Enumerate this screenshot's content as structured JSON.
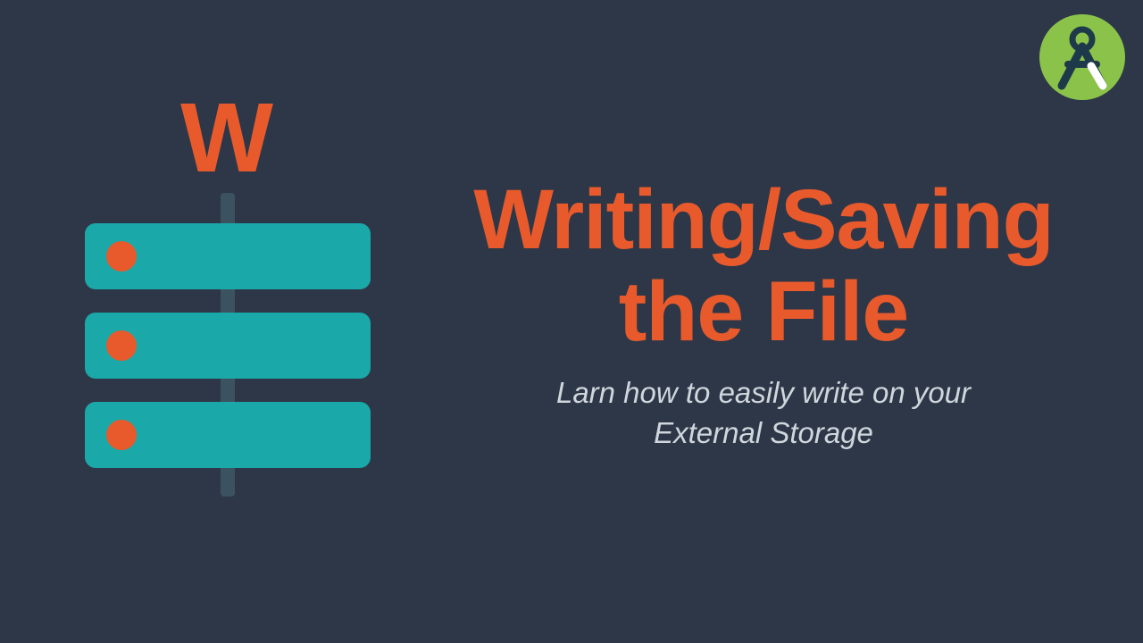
{
  "illustration": {
    "letter": "W"
  },
  "content": {
    "title_line1": "Writing/Saving",
    "title_line2": "the File",
    "subtitle_line1": "Larn how to easily write on your",
    "subtitle_line2": "External Storage"
  },
  "colors": {
    "background": "#2d3748",
    "accent_orange": "#e85a2b",
    "accent_teal": "#1aa8a8",
    "logo_green": "#8bc34a",
    "logo_dark": "#1e3a4a"
  }
}
